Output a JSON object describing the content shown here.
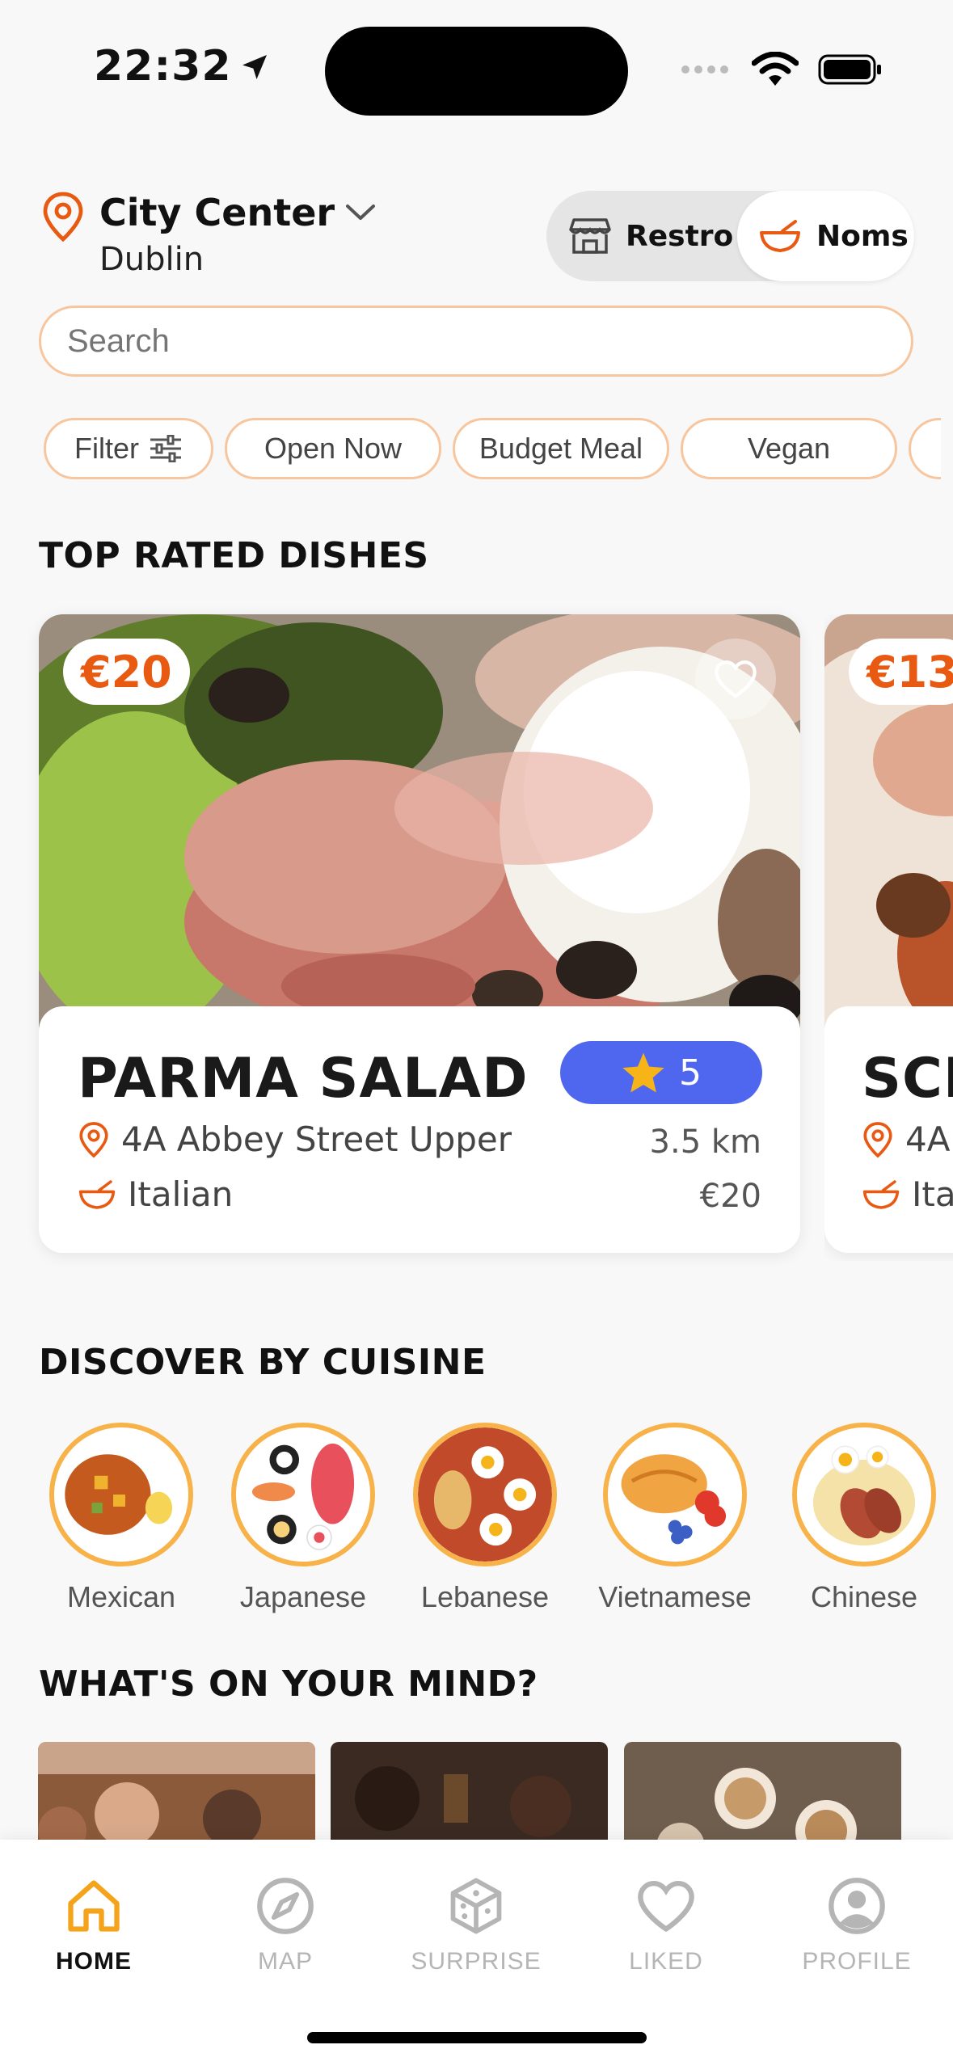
{
  "status_bar": {
    "time": "22:32"
  },
  "location": {
    "title": "City Center",
    "city": "Dublin"
  },
  "mode_toggle": {
    "restro_label": "Restro",
    "noms_label": "Noms",
    "selected": "Noms"
  },
  "search": {
    "placeholder": "Search"
  },
  "filters": [
    {
      "label": "Filter"
    },
    {
      "label": "Open Now"
    },
    {
      "label": "Budget Meal"
    },
    {
      "label": "Vegan"
    }
  ],
  "top_rated": {
    "title": "TOP RATED DISHES",
    "cards": [
      {
        "price_badge": "€20",
        "name": "PARMA SALAD",
        "rating": "5",
        "address": "4A Abbey Street Upper",
        "cuisine": "Italian",
        "distance": "3.5 km",
        "price": "€20"
      },
      {
        "price_badge": "€13",
        "name": "SCH",
        "address": "4A",
        "cuisine": "Ita"
      }
    ]
  },
  "discover": {
    "title": "DISCOVER BY CUISINE",
    "cuisines": [
      {
        "label": "Mexican"
      },
      {
        "label": "Japanese"
      },
      {
        "label": "Lebanese"
      },
      {
        "label": "Vietnamese"
      },
      {
        "label": "Chinese"
      }
    ]
  },
  "mind": {
    "title": "WHAT'S ON YOUR MIND?"
  },
  "tab_bar": {
    "items": [
      {
        "label": "HOME",
        "icon": "home-icon"
      },
      {
        "label": "MAP",
        "icon": "compass-icon"
      },
      {
        "label": "SURPRISE",
        "icon": "dice-icon"
      },
      {
        "label": "LIKED",
        "icon": "heart-icon"
      },
      {
        "label": "PROFILE",
        "icon": "profile-icon"
      }
    ],
    "active": "HOME"
  },
  "colors": {
    "accent": "#e85a12",
    "chip_border": "#f7c69e",
    "rating_bg": "#4f67ee",
    "home_orange": "#f5a31a"
  }
}
